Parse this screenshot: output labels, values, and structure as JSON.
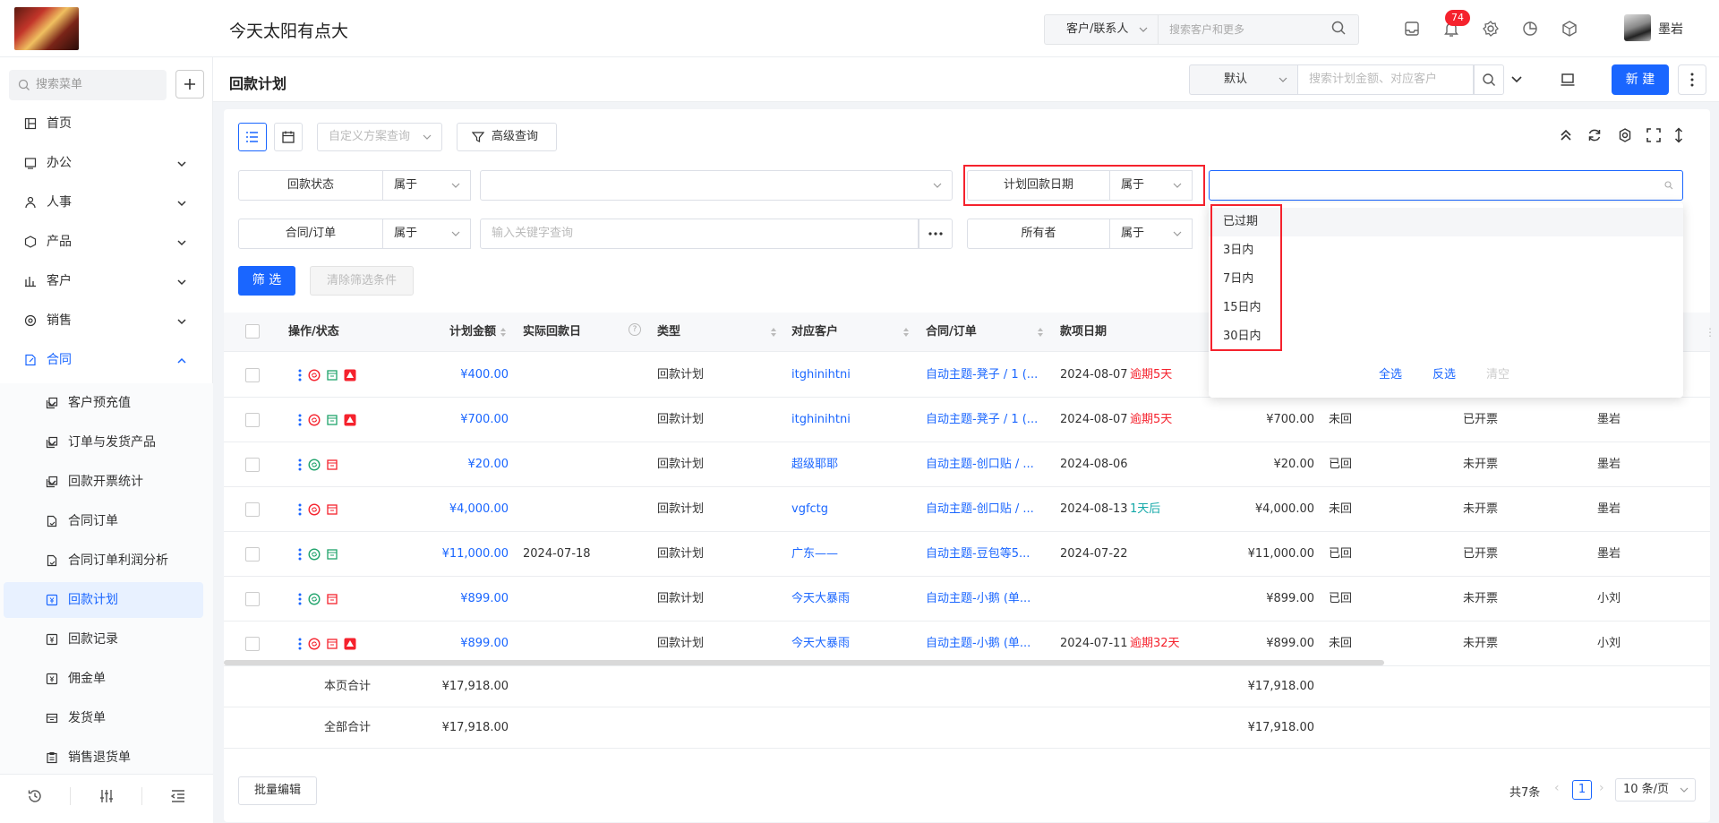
{
  "header": {
    "company": "今天太阳有点大",
    "search_scope": "客户/联系人",
    "search_placeholder": "搜索客户和更多",
    "notification_count": "74",
    "username": "墨岩"
  },
  "sidebar": {
    "search_placeholder": "搜索菜单",
    "items": [
      {
        "label": "首页",
        "icon": "home-icon"
      },
      {
        "label": "办公",
        "icon": "office-icon"
      },
      {
        "label": "人事",
        "icon": "hr-icon"
      },
      {
        "label": "产品",
        "icon": "product-icon"
      },
      {
        "label": "客户",
        "icon": "customer-icon"
      },
      {
        "label": "销售",
        "icon": "sales-icon"
      },
      {
        "label": "合同",
        "icon": "contract-icon"
      }
    ],
    "subitems": [
      {
        "label": "客户预充值"
      },
      {
        "label": "订单与发货产品"
      },
      {
        "label": "回款开票统计"
      },
      {
        "label": "合同订单"
      },
      {
        "label": "合同订单利润分析"
      },
      {
        "label": "回款计划"
      },
      {
        "label": "回款记录"
      },
      {
        "label": "佣金单"
      },
      {
        "label": "发货单"
      },
      {
        "label": "销售退货单"
      }
    ]
  },
  "page": {
    "title": "回款计划",
    "view": "默认",
    "search_placeholder": "搜索计划金额、对应客户",
    "new_label": "新 建"
  },
  "toolbar": {
    "custom_query_placeholder": "自定义方案查询",
    "advanced_query": "高级查询"
  },
  "filters": {
    "status_label": "回款状态",
    "status_op": "属于",
    "plan_date_label": "计划回款日期",
    "plan_date_op": "属于",
    "contract_label": "合同/订单",
    "contract_op": "属于",
    "contract_placeholder": "输入关键字查询",
    "owner_label": "所有者",
    "owner_op": "属于",
    "filter_btn": "筛 选",
    "clear_btn": "清除筛选条件"
  },
  "dropdown": {
    "options": [
      "已过期",
      "3日内",
      "7日内",
      "15日内",
      "30日内"
    ],
    "select_all": "全选",
    "invert": "反选",
    "clear": "清空"
  },
  "table": {
    "columns": [
      "操作/状态",
      "计划金额",
      "实际回款日",
      "类型",
      "对应客户",
      "合同/订单",
      "款项日期"
    ],
    "rows": [
      {
        "amount": "¥400.00",
        "actual_date": "",
        "type": "回款计划",
        "customer": "itghinihtni",
        "contract": "自动主题-凳子 / 1 (...",
        "date": "2024-08-07",
        "date_note": "逾期5天",
        "note_color": "red",
        "amount2": "",
        "paid": "",
        "invoice": "",
        "owner": "",
        "status_icon": "red",
        "has_alert": true
      },
      {
        "amount": "¥700.00",
        "actual_date": "",
        "type": "回款计划",
        "customer": "itghinihtni",
        "contract": "自动主题-凳子 / 1 (...",
        "date": "2024-08-07",
        "date_note": "逾期5天",
        "note_color": "red",
        "amount2": "¥700.00",
        "paid": "未回",
        "invoice": "已开票",
        "owner": "墨岩",
        "status_icon": "red",
        "has_alert": true
      },
      {
        "amount": "¥20.00",
        "actual_date": "",
        "type": "回款计划",
        "customer": "超级耶耶",
        "contract": "自动主题-创口贴 / ...",
        "date": "2024-08-06",
        "date_note": "",
        "note_color": "",
        "amount2": "¥20.00",
        "paid": "已回",
        "invoice": "未开票",
        "owner": "墨岩",
        "status_icon": "green",
        "has_alert": false
      },
      {
        "amount": "¥4,000.00",
        "actual_date": "",
        "type": "回款计划",
        "customer": "vgfctg",
        "contract": "自动主题-创口贴 / ...",
        "date": "2024-08-13",
        "date_note": "1天后",
        "note_color": "teal",
        "amount2": "¥4,000.00",
        "paid": "未回",
        "invoice": "未开票",
        "owner": "墨岩",
        "status_icon": "red",
        "has_alert": false
      },
      {
        "amount": "¥11,000.00",
        "actual_date": "2024-07-18",
        "type": "回款计划",
        "customer": "广东——",
        "contract": "自动主题-豆包等5...",
        "date": "2024-07-22",
        "date_note": "",
        "note_color": "",
        "amount2": "¥11,000.00",
        "paid": "已回",
        "invoice": "已开票",
        "owner": "墨岩",
        "status_icon": "green",
        "has_alert": false
      },
      {
        "amount": "¥899.00",
        "actual_date": "",
        "type": "回款计划",
        "customer": "今天大暴雨",
        "contract": "自动主题-小鹅 (单...",
        "date": "",
        "date_note": "",
        "note_color": "",
        "amount2": "¥899.00",
        "paid": "已回",
        "invoice": "未开票",
        "owner": "小刘",
        "status_icon": "green",
        "has_alert": false
      },
      {
        "amount": "¥899.00",
        "actual_date": "",
        "type": "回款计划",
        "customer": "今天大暴雨",
        "contract": "自动主题-小鹅 (单...",
        "date": "2024-07-11",
        "date_note": "逾期32天",
        "note_color": "red",
        "amount2": "¥899.00",
        "paid": "未回",
        "invoice": "未开票",
        "owner": "小刘",
        "status_icon": "red",
        "has_alert": true
      }
    ],
    "page_total_label": "本页合计",
    "page_total": "¥17,918.00",
    "page_total2": "¥17,918.00",
    "all_total_label": "全部合计",
    "all_total": "¥17,918.00",
    "all_total2": "¥17,918.00"
  },
  "footer": {
    "batch_edit": "批量编辑",
    "total": "共7条",
    "page": "1",
    "page_size": "10 条/页"
  },
  "colors": {
    "accent": "#1a66ff",
    "danger": "#f5222d",
    "success": "#1fa36b",
    "teal": "#13a8a8"
  }
}
